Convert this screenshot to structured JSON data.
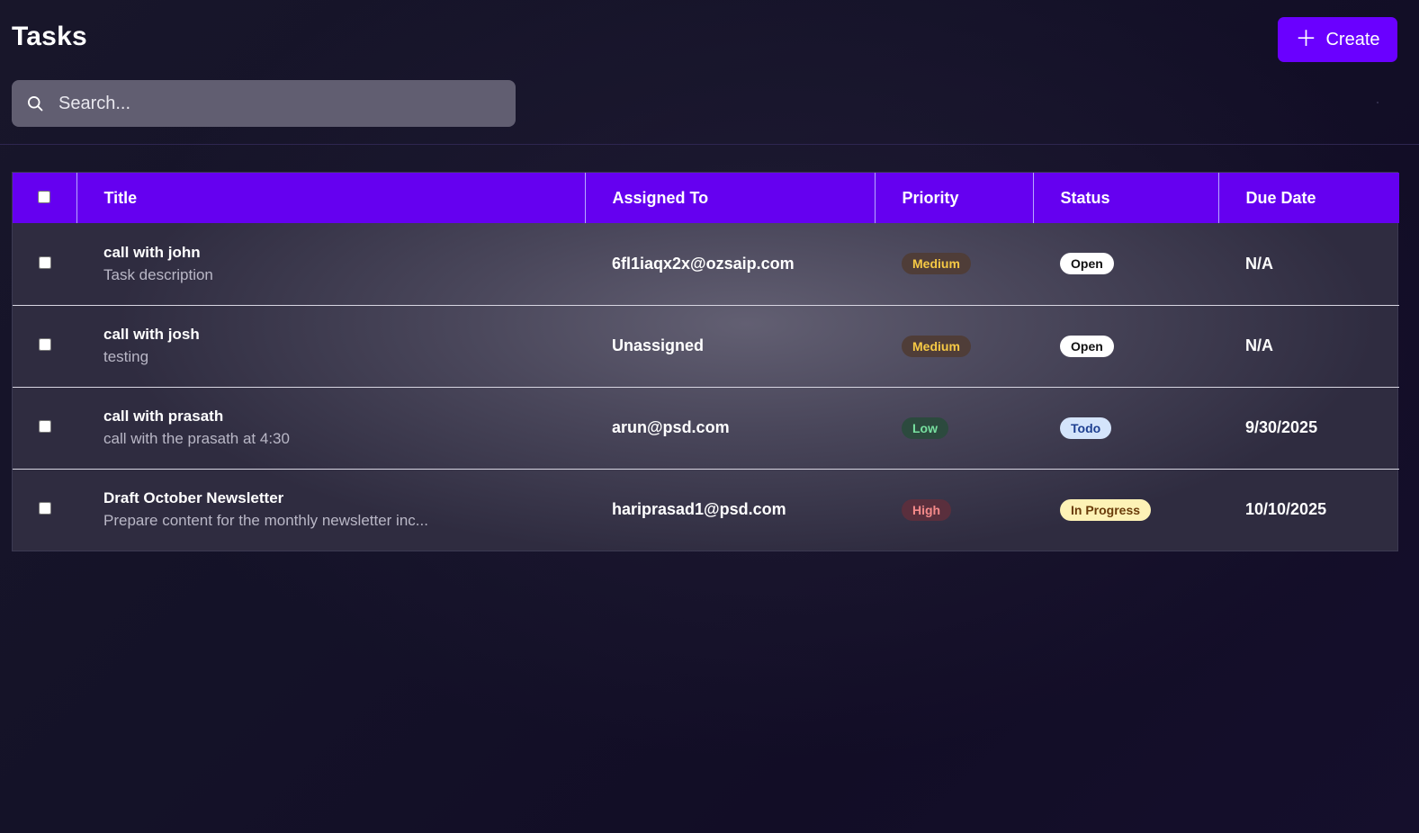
{
  "header": {
    "title": "Tasks",
    "create_label": "Create",
    "search_placeholder": "Search..."
  },
  "table": {
    "columns": [
      "Title",
      "Assigned To",
      "Priority",
      "Status",
      "Due Date"
    ],
    "rows": [
      {
        "title": "call with john",
        "description": "Task description",
        "assigned_to": "6fl1iaqx2x@ozsaip.com",
        "priority": "Medium",
        "status": "Open",
        "due_date": "N/A"
      },
      {
        "title": "call with josh",
        "description": "testing",
        "assigned_to": "Unassigned",
        "priority": "Medium",
        "status": "Open",
        "due_date": "N/A"
      },
      {
        "title": "call with prasath",
        "description": "call with the prasath at 4:30",
        "assigned_to": "arun@psd.com",
        "priority": "Low",
        "status": "Todo",
        "due_date": "9/30/2025"
      },
      {
        "title": "Draft October Newsletter",
        "description": "Prepare content for the monthly newsletter inc...",
        "assigned_to": "hariprasad1@psd.com",
        "priority": "High",
        "status": "In Progress",
        "due_date": "10/10/2025"
      }
    ]
  },
  "colors": {
    "accent": "#6500f0",
    "button": "#6a00ff",
    "search_bg": "#615e71"
  }
}
